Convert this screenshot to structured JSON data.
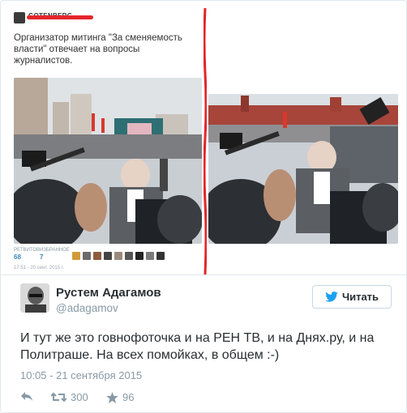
{
  "embedded_screenshot": {
    "account_name": "GOTENBERG",
    "text": "Организатор митинга \"За сменяемость власти\" отвечает на вопросы журналистов.",
    "stats": [
      {
        "label": "РЕТВИТОВ",
        "value": "68"
      },
      {
        "label": "ИЗБРАННОЕ",
        "value": "7"
      }
    ],
    "date": "17:51 - 20 сент. 2015 г."
  },
  "tweet": {
    "author_name": "Рустем Адагамов",
    "author_handle": "@adagamov",
    "follow_label": "Читать",
    "text": "И тут же это говнофоточка и на РЕН ТВ, и на Днях.ру, и на Политраше. На всех помойках, в общем :-)",
    "date": "10:05 - 21 сентября 2015",
    "retweets": "300",
    "likes": "96"
  },
  "colors": {
    "twitter_blue": "#1da1f2",
    "muted": "#8899a6",
    "text": "#292f33",
    "annotation_red": "#e3262b"
  },
  "icons": [
    "bird-icon",
    "reply-icon",
    "retweet-icon",
    "star-icon"
  ]
}
